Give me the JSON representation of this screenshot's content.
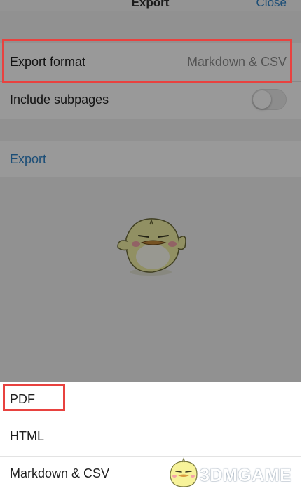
{
  "nav": {
    "title": "Export",
    "close_label": "Close"
  },
  "settings": {
    "format_label": "Export format",
    "format_value": "Markdown & CSV",
    "subpages_label": "Include subpages",
    "subpages_enabled": false,
    "export_action": "Export"
  },
  "sheet": {
    "options": [
      {
        "label": "PDF"
      },
      {
        "label": "HTML"
      },
      {
        "label": "Markdown & CSV"
      }
    ]
  },
  "watermark": {
    "text": "3DMGAME"
  },
  "colors": {
    "accent": "#2f82c7",
    "highlight": "#e8423f",
    "background": "#f2f2f2"
  }
}
